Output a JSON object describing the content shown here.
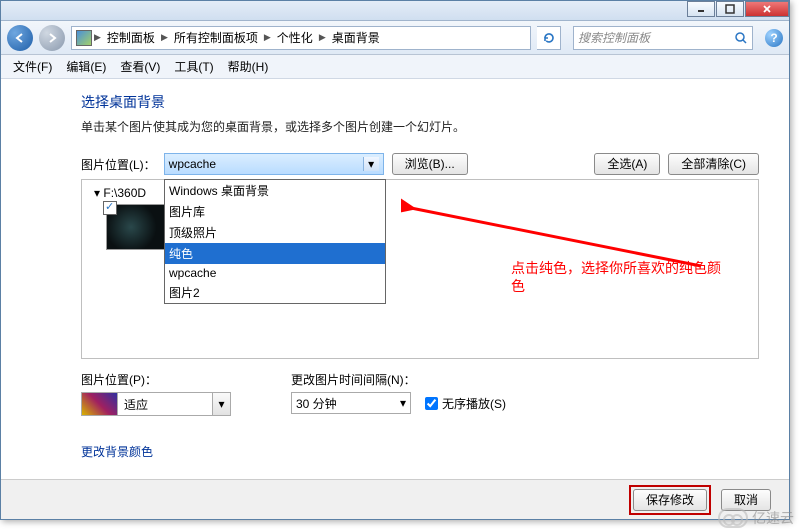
{
  "titlebar": {
    "min_tip": "最小化",
    "max_tip": "最大化",
    "close_tip": "关闭"
  },
  "nav": {
    "back_tip": "返回",
    "forward_tip": "前进",
    "crumbs": [
      "控制面板",
      "所有控制面板项",
      "个性化",
      "桌面背景"
    ],
    "search_placeholder": "搜索控制面板"
  },
  "menu": {
    "file": "文件(F)",
    "edit": "编辑(E)",
    "view": "查看(V)",
    "tools": "工具(T)",
    "help": "帮助(H)"
  },
  "main": {
    "title": "选择桌面背景",
    "subtitle": "单击某个图片使其成为您的桌面背景，或选择多个图片创建一个幻灯片。",
    "location_label": "图片位置(L)：",
    "location_value": "wpcache",
    "browse_btn": "浏览(B)...",
    "select_all_btn": "全选(A)",
    "clear_all_btn": "全部清除(C)",
    "dropdown_items": [
      "Windows 桌面背景",
      "图片库",
      "顶级照片",
      "纯色",
      "wpcache",
      "图片2"
    ],
    "dropdown_highlight_index": 3,
    "tree_root": "F:\\360D",
    "fit_label": "图片位置(P)：",
    "fit_value": "适应",
    "interval_label": "更改图片时间间隔(N)：",
    "interval_value": "30 分钟",
    "shuffle_label": "无序播放(S)",
    "shuffle_checked": true,
    "color_link": "更改背景颜色"
  },
  "annotation": {
    "text_line1": "点击纯色，选择你所喜欢的纯色颜",
    "text_line2": "色"
  },
  "footer": {
    "save_btn": "保存修改",
    "cancel_btn": "取消"
  },
  "watermark": "亿速云"
}
